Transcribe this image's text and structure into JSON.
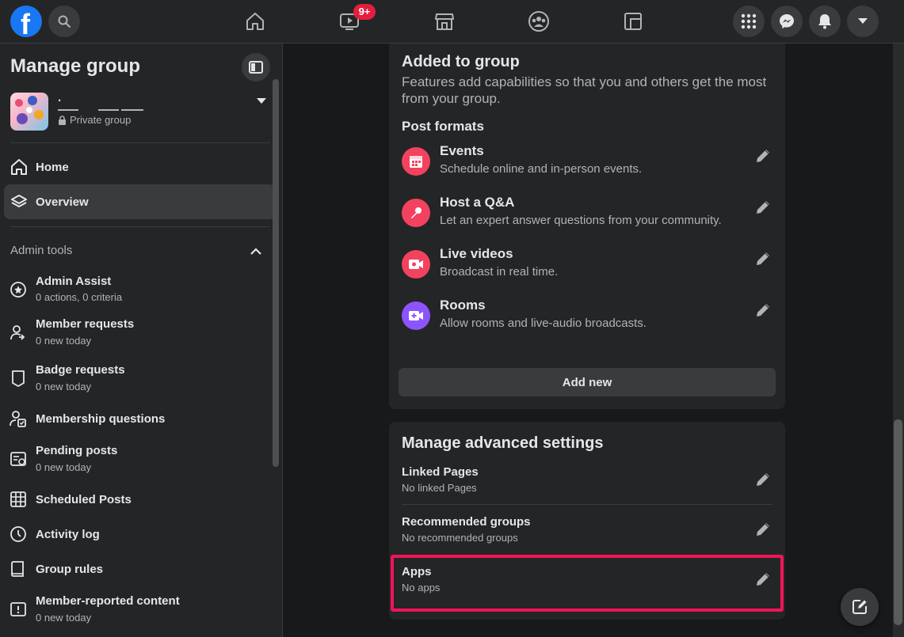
{
  "topbar": {
    "logo_letter": "f",
    "watch_badge": "9+"
  },
  "sidebar": {
    "title": "Manage group",
    "group": {
      "name": "·",
      "privacy": "Private group"
    },
    "nav": [
      {
        "label": "Home"
      },
      {
        "label": "Overview"
      }
    ],
    "admin_tools_heading": "Admin tools",
    "tools": [
      {
        "title": "Admin Assist",
        "subtitle": "0 actions, 0 criteria"
      },
      {
        "title": "Member requests",
        "subtitle": "0 new today"
      },
      {
        "title": "Badge requests",
        "subtitle": "0 new today"
      },
      {
        "title": "Membership questions",
        "subtitle": ""
      },
      {
        "title": "Pending posts",
        "subtitle": "0 new today"
      },
      {
        "title": "Scheduled Posts",
        "subtitle": ""
      },
      {
        "title": "Activity log",
        "subtitle": ""
      },
      {
        "title": "Group rules",
        "subtitle": ""
      },
      {
        "title": "Member-reported content",
        "subtitle": "0 new today"
      }
    ]
  },
  "added_card": {
    "title": "Added to group",
    "description": "Features add capabilities so that you and others get the most from your group.",
    "post_formats_heading": "Post formats",
    "features": [
      {
        "title": "Events",
        "subtitle": "Schedule online and in-person events.",
        "color": "#f3425f"
      },
      {
        "title": "Host a Q&A",
        "subtitle": "Let an expert answer questions from your community.",
        "color": "#f3425f"
      },
      {
        "title": "Live videos",
        "subtitle": "Broadcast in real time.",
        "color": "#f3425f"
      },
      {
        "title": "Rooms",
        "subtitle": "Allow rooms and live-audio broadcasts.",
        "color": "#8c54ff"
      }
    ],
    "add_new_label": "Add new"
  },
  "advanced_card": {
    "title": "Manage advanced settings",
    "settings": [
      {
        "title": "Linked Pages",
        "subtitle": "No linked Pages"
      },
      {
        "title": "Recommended groups",
        "subtitle": "No recommended groups"
      },
      {
        "title": "Apps",
        "subtitle": "No apps"
      }
    ]
  },
  "colors": {
    "accent": "#1877f2",
    "highlight": "#f0145a"
  }
}
